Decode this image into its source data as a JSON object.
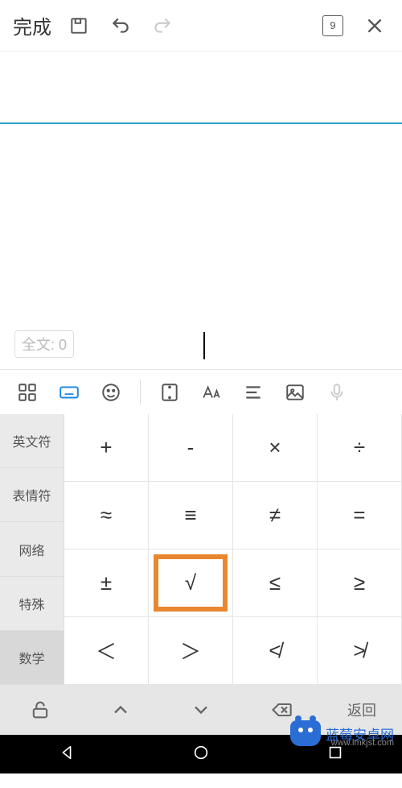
{
  "toolbar": {
    "done": "完成",
    "page_number": "9"
  },
  "editor": {
    "word_count_label": "全文: 0"
  },
  "categories": [
    "英文符",
    "表情符",
    "网络",
    "特殊",
    "数学"
  ],
  "selected_category_index": 4,
  "symbols": [
    "+",
    "-",
    "×",
    "÷",
    "≈",
    "≡",
    "≠",
    "=",
    "±",
    "√",
    "≤",
    "≥",
    "＜",
    "＞",
    "≮",
    "≯"
  ],
  "highlighted_symbol_index": 9,
  "bottom_bar": {
    "return": "返回"
  },
  "watermark": {
    "title": "蓝莓安卓网",
    "url": "www.lmkjst.com"
  }
}
